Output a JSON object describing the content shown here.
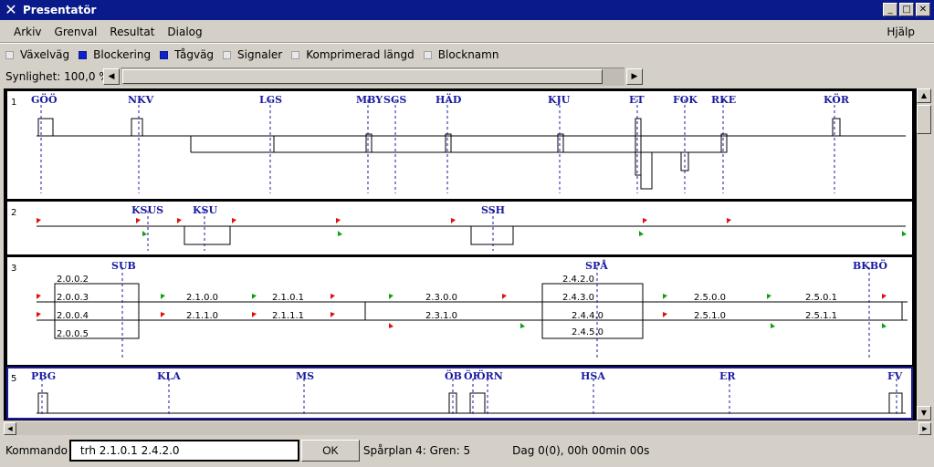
{
  "window": {
    "title": "Presentatör"
  },
  "menu": {
    "items": [
      "Arkiv",
      "Grenval",
      "Resultat",
      "Dialog"
    ],
    "help": "Hjälp"
  },
  "options": [
    {
      "label": "Växelväg",
      "checked": false
    },
    {
      "label": "Blockering",
      "checked": true
    },
    {
      "label": "Tågväg",
      "checked": true
    },
    {
      "label": "Signaler",
      "checked": false
    },
    {
      "label": "Komprimerad längd",
      "checked": false
    },
    {
      "label": "Blocknamn",
      "checked": false
    }
  ],
  "speed": {
    "label": "Synlighet: 100,0 %"
  },
  "panels": [
    {
      "number": "1",
      "stations": [
        "GÖÖ",
        "NKV",
        "LGS",
        "MBY",
        "SGS",
        "HÄD",
        "KJU",
        "ET",
        "FOK",
        "RKE",
        "KÖR"
      ]
    },
    {
      "number": "2",
      "stations": [
        "KSUS",
        "KSU",
        "SSH"
      ]
    },
    {
      "number": "3",
      "stations": [
        "SUB",
        "SPÅ",
        "BKBÖ"
      ],
      "tracks": [
        "2.0.0.2",
        "2.0.0.3",
        "2.0.0.4",
        "2.0.0.5",
        "2.1.0.0",
        "2.1.1.0",
        "2.1.0.1",
        "2.1.1.1",
        "2.3.0.0",
        "2.3.1.0",
        "2.4.2.0",
        "2.4.3.0",
        "2.4.4.0",
        "2.4.5.0",
        "2.5.0.0",
        "2.5.1.0",
        "2.5.0.1",
        "2.5.1.1"
      ]
    },
    {
      "number": "5",
      "stations": [
        "PBG",
        "KLA",
        "MS",
        "ÖB",
        "ÖF",
        "ÖRN",
        "HSA",
        "ER",
        "FV"
      ]
    }
  ],
  "command": {
    "label": "Kommando",
    "value": "trh 2.1.0.1 2.4.2.0",
    "ok": "OK"
  },
  "status": {
    "plan": "Spårplan 4: Gren: 5",
    "time": "Dag 0(0), 00h 00min 00s"
  },
  "colors": {
    "titlebar": "#0a1a8a",
    "station": "#1a1aa0",
    "signal_red": "#e01010",
    "signal_green": "#10a010"
  }
}
